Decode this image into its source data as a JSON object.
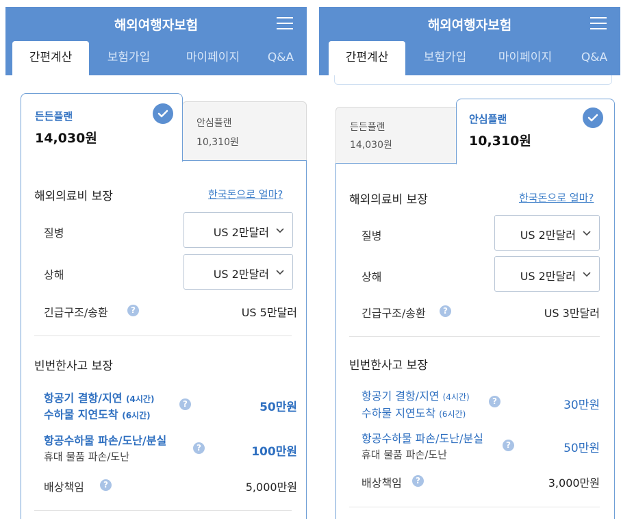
{
  "header": {
    "title": "해외여행자보험",
    "menu_icon": "hamburger-menu-icon"
  },
  "tabs": [
    "간편계산",
    "보험가입",
    "마이페이지",
    "Q&A"
  ],
  "plans": {
    "a_name": "든든플랜",
    "a_price": "14,030원",
    "b_name": "안심플랜",
    "b_price": "10,310원"
  },
  "medical": {
    "title": "해외의료비 보장",
    "link": "한국돈으로 얼마?",
    "illness_label": "질병",
    "illness_value": "US 2만달러",
    "injury_label": "상해",
    "injury_value": "US 2만달러",
    "rescue_label": "긴급구조/송환"
  },
  "frequent": {
    "title": "빈번한사고 보장",
    "flight_line1": "항공기 결항/지연",
    "flight_line1_small": "(4시간)",
    "flight_line2": "수하물 지연도착",
    "flight_line2_small": "(6시간)",
    "baggage_line1": "항공수하물 파손/도난/분실",
    "baggage_line2": "휴대 물품 파손/도난",
    "liability_label": "배상책임"
  },
  "left": {
    "rescue_value": "US 5만달러",
    "flight_amount": "50만원",
    "baggage_amount": "100만원",
    "liability_amount": "5,000만원"
  },
  "right": {
    "rescue_value": "US 3만달러",
    "flight_amount": "30만원",
    "baggage_amount": "50만원",
    "liability_amount": "3,000만원"
  },
  "colors": {
    "header": "#5b8fd1",
    "accent": "#2e6fc0"
  }
}
